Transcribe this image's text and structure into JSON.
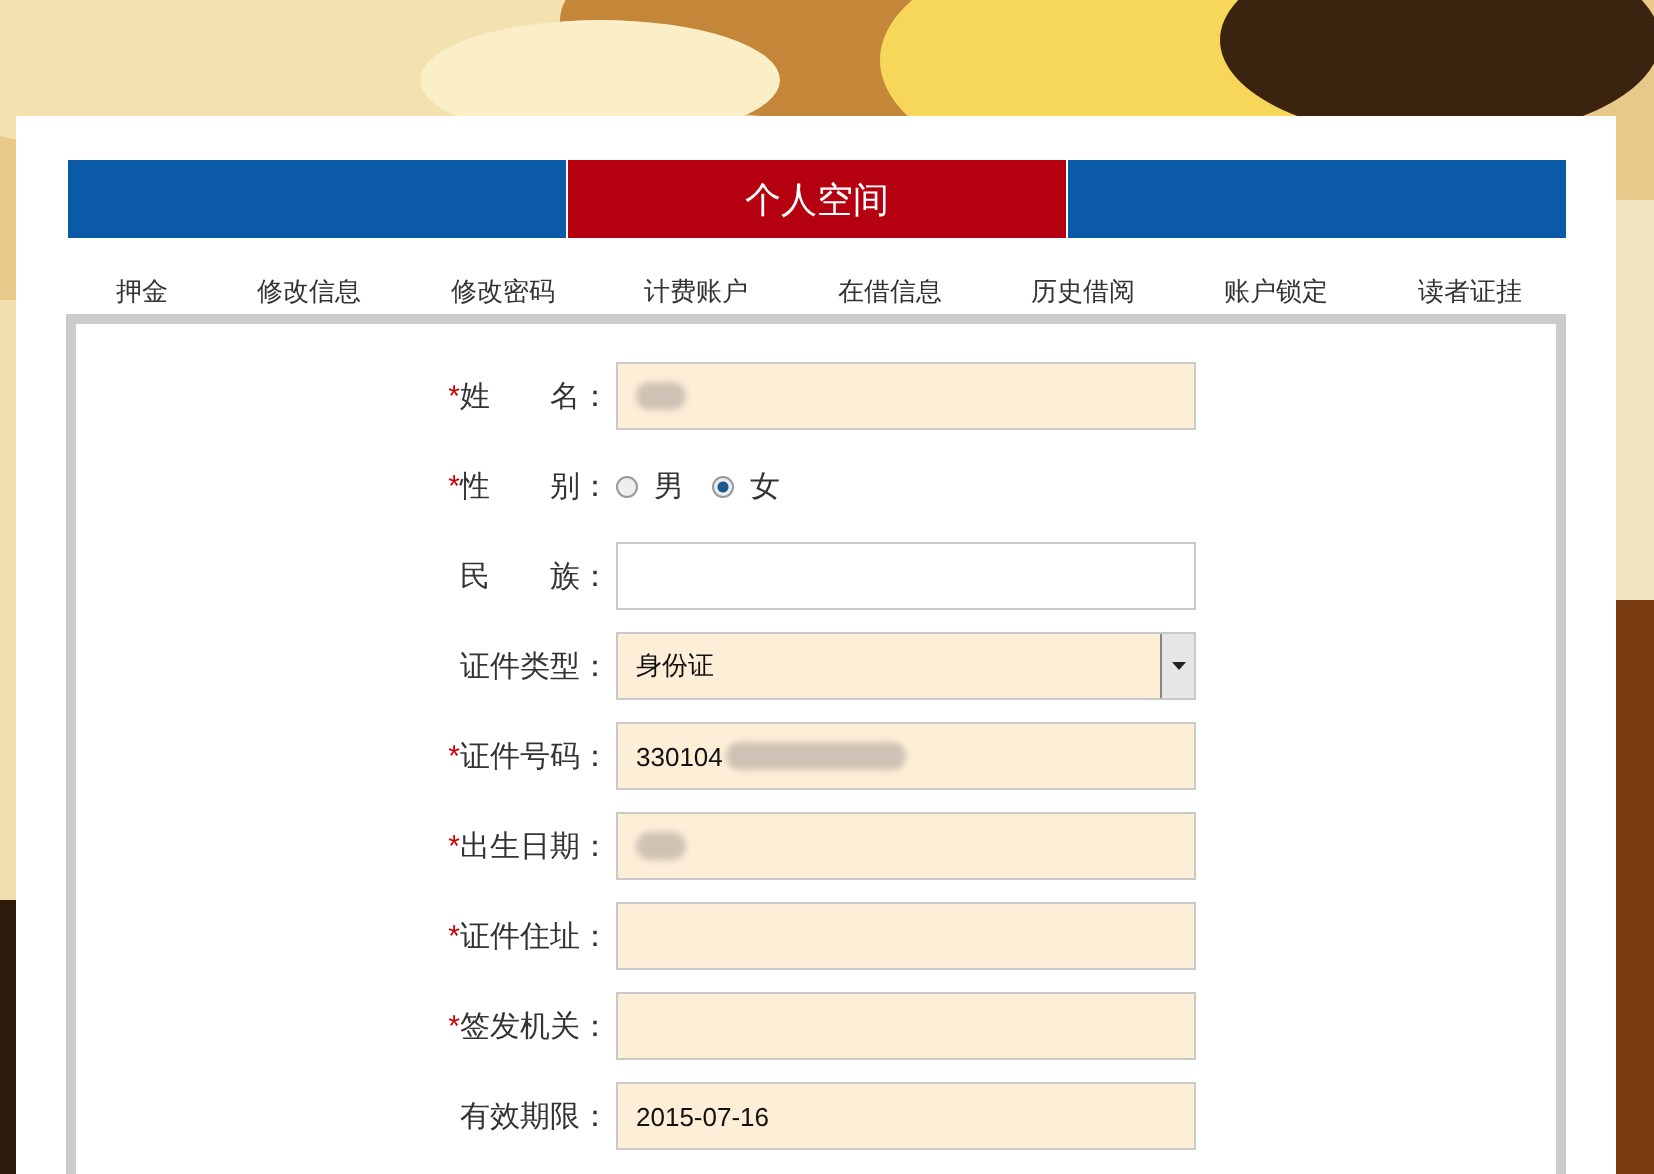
{
  "header": {
    "title": "个人空间"
  },
  "tabs": [
    {
      "label": "押金",
      "selected": false
    },
    {
      "label": "修改信息",
      "selected": false
    },
    {
      "label": "修改密码",
      "selected": false
    },
    {
      "label": "计费账户",
      "selected": false
    },
    {
      "label": "在借信息",
      "selected": false
    },
    {
      "label": "历史借阅",
      "selected": false
    },
    {
      "label": "账户锁定",
      "selected": false
    },
    {
      "label": "读者证挂",
      "selected": false
    }
  ],
  "form": [
    {
      "kind": "text",
      "label": "姓　　名：",
      "required_mark": "*",
      "redacted": true,
      "filled": true
    },
    {
      "kind": "radio",
      "label": "性　　别：",
      "required_mark": "*",
      "options": [
        {
          "label": "男",
          "selected": false
        },
        {
          "label": "女",
          "selected": true
        }
      ]
    },
    {
      "kind": "text",
      "label": "民　　族：",
      "filled": false
    },
    {
      "kind": "select",
      "label": "证件类型：",
      "value": "身份证"
    },
    {
      "kind": "text",
      "label": "证件号码：",
      "required_mark": "*",
      "value": "330104",
      "redacted": true,
      "filled": true
    },
    {
      "kind": "text",
      "label": "出生日期：",
      "required_mark": "*",
      "redacted": true,
      "filled": true
    },
    {
      "kind": "text",
      "label": "证件住址：",
      "required_mark": "*",
      "filled": true
    },
    {
      "kind": "text",
      "label": "签发机关：",
      "required_mark": "*",
      "filled": true
    },
    {
      "kind": "text",
      "label": "有效期限：",
      "value": "2015-07-16",
      "filled": true
    }
  ]
}
